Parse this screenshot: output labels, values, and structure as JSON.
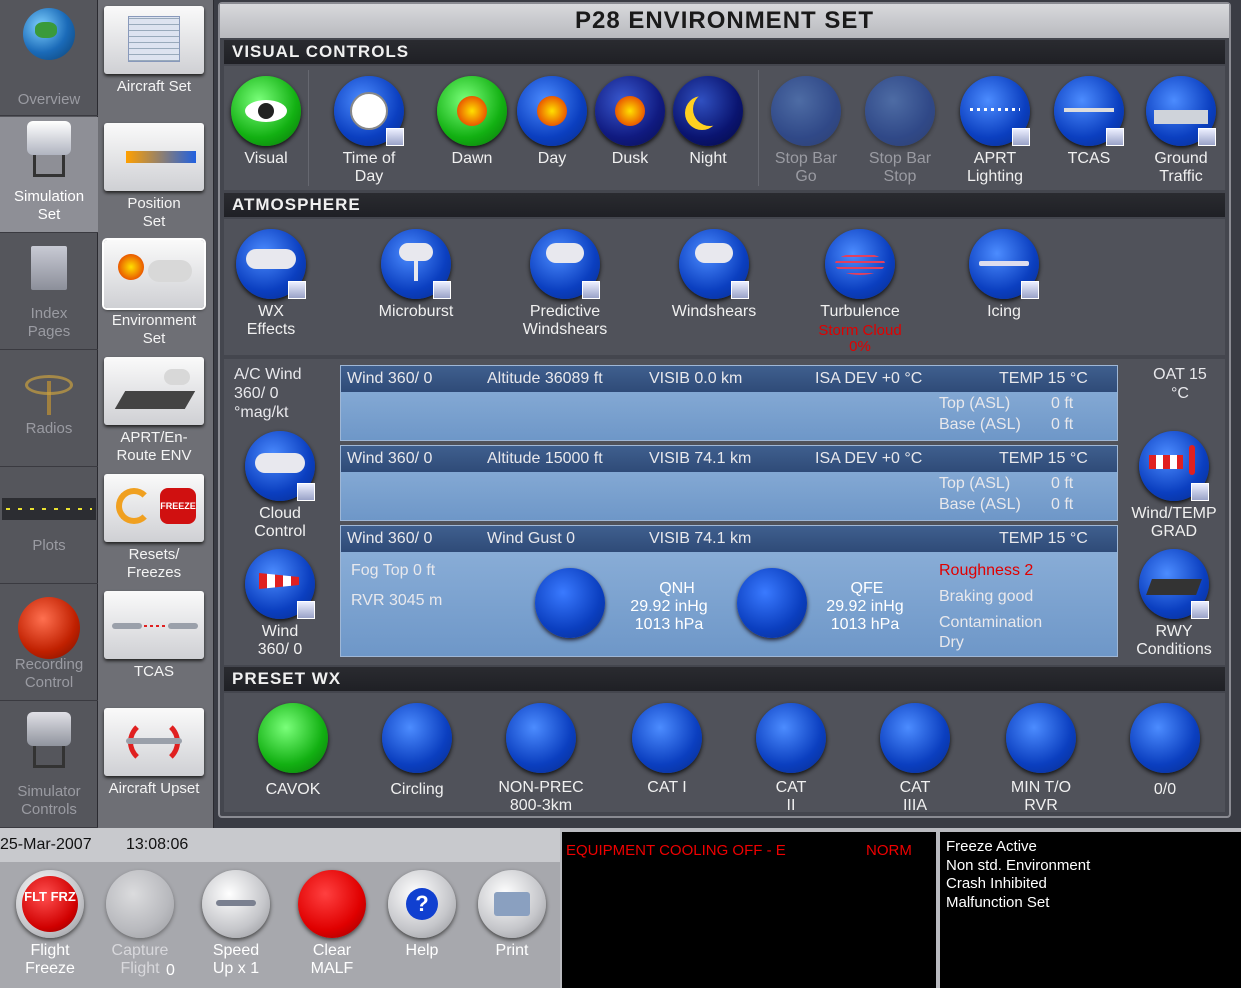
{
  "left_nav": [
    {
      "label": "Overview"
    },
    {
      "label": "Simulation Set"
    },
    {
      "label": "Index Pages"
    },
    {
      "label": "Radios"
    },
    {
      "label": "Plots"
    },
    {
      "label": "Recording Control"
    },
    {
      "label": "Simulator Controls"
    }
  ],
  "mid_nav": [
    {
      "label": "Aircraft Set"
    },
    {
      "label": "Position Set"
    },
    {
      "label": "Environment Set"
    },
    {
      "label": "APRT/En-Route ENV"
    },
    {
      "label": "Resets/ Freezes"
    },
    {
      "label": "TCAS"
    },
    {
      "label": "Aircraft Upset"
    }
  ],
  "freeze_icon_text": "FREEZE",
  "title": "P28 ENVIRONMENT SET",
  "sections": {
    "visual": "VISUAL CONTROLS",
    "atmosphere": "ATMOSPHERE",
    "preset": "PRESET WX"
  },
  "visual_controls": [
    {
      "label": "Visual"
    },
    {
      "label": "Time of Day"
    },
    {
      "label": "Dawn"
    },
    {
      "label": "Day"
    },
    {
      "label": "Dusk"
    },
    {
      "label": "Night"
    },
    {
      "label": "Stop Bar Go"
    },
    {
      "label": "Stop Bar Stop"
    },
    {
      "label": "APRT Lighting"
    },
    {
      "label": "TCAS"
    },
    {
      "label": "Ground Traffic"
    }
  ],
  "atmosphere": [
    {
      "label": "WX Effects"
    },
    {
      "label": "Microburst"
    },
    {
      "label": "Predictive Windshears"
    },
    {
      "label": "Windshears"
    },
    {
      "label": "Turbulence"
    },
    {
      "label": "Icing"
    }
  ],
  "turbulence_sub": "Storm Cloud",
  "turbulence_pct": "0%",
  "ac_wind": "A/C Wind 360/ 0 °mag/kt",
  "cloud_control": "Cloud Control",
  "wind_btn": "Wind 360/ 0",
  "oat": "OAT 15 °C",
  "wind_temp_grad": "Wind/TEMP GRAD",
  "rwy_conditions": "RWY Conditions",
  "layer1": {
    "wind": "Wind 360/  0",
    "alt": "Altitude 36089 ft",
    "visib": "VISIB   0.0 km",
    "isa": "ISA DEV  +0 °C",
    "temp": "TEMP   15 °C",
    "top_label": "Top (ASL)",
    "top_val": "0 ft",
    "base_label": "Base (ASL)",
    "base_val": "0 ft"
  },
  "layer2": {
    "wind": "Wind 360/  0",
    "alt": "Altitude 15000 ft",
    "visib": "VISIB   74.1 km",
    "isa": "ISA DEV  +0 °C",
    "temp": "TEMP   15 °C",
    "top_label": "Top (ASL)",
    "top_val": "0 ft",
    "base_label": "Base (ASL)",
    "base_val": "0 ft"
  },
  "surface": {
    "wind": "Wind 360/  0",
    "gust": "Wind Gust  0",
    "visib": "VISIB   74.1 km",
    "temp": "TEMP   15 °C",
    "fog": "Fog Top    0 ft",
    "rvr": "RVR 3045 m",
    "qnh_label": "QNH",
    "qnh_inhg": "29.92 inHg",
    "qnh_hpa": "1013 hPa",
    "qfe_label": "QFE",
    "qfe_inhg": "29.92 inHg",
    "qfe_hpa": "1013 hPa",
    "roughness": "Roughness 2",
    "braking": "Braking good",
    "contamination": "Contamination",
    "contamination_val": "Dry"
  },
  "preset_wx": [
    {
      "label": "CAVOK"
    },
    {
      "label": "Circling"
    },
    {
      "label": "NON-PREC 800-3km"
    },
    {
      "label": "CAT I"
    },
    {
      "label": "CAT II"
    },
    {
      "label": "CAT IIIA"
    },
    {
      "label": "MIN T/O RVR"
    },
    {
      "label": "0/0"
    }
  ],
  "date": "25-Mar-2007",
  "time": "13:08:06",
  "bottom_buttons": [
    {
      "label": "Flight Freeze"
    },
    {
      "label": "Capture Flight"
    },
    {
      "label": "Speed Up x 1"
    },
    {
      "label": "Clear MALF"
    },
    {
      "label": "Help"
    },
    {
      "label": "Print"
    }
  ],
  "flt_frz_text": "FLT FRZ",
  "capture_count": "0",
  "message": "EQUIPMENT COOLING OFF - E",
  "message_status": "NORM",
  "status_lines": [
    "Freeze Active",
    "Non std. Environment",
    "Crash Inhibited",
    "Malfunction Set"
  ],
  "colors": {
    "accent_blue": "#0b3fc0",
    "warning_red": "#e00000",
    "active_green": "#12b012"
  }
}
